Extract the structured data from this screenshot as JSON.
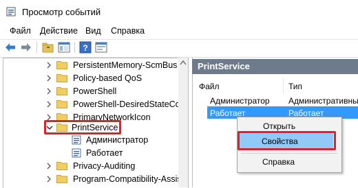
{
  "window": {
    "title": "Просмотр событий"
  },
  "menu": [
    "Файл",
    "Действие",
    "Вид",
    "Справка"
  ],
  "toolbar": {
    "icons": [
      "back-arrow-icon",
      "forward-arrow-icon",
      "folder-up-icon",
      "show-hide-tree-icon",
      "help-icon",
      "properties-icon"
    ]
  },
  "tree": {
    "items": [
      {
        "label": "PersistentMemory-ScmBus",
        "expanded": false
      },
      {
        "label": "Policy-based QoS",
        "expanded": false
      },
      {
        "label": "PowerShell",
        "expanded": false
      },
      {
        "label": "PowerShell-DesiredStateConf",
        "expanded": false
      },
      {
        "label": "PrimaryNetworkIcon",
        "expanded": false
      },
      {
        "label": "PrintService",
        "expanded": true,
        "selected": true
      },
      {
        "label": "Администратор",
        "child": true
      },
      {
        "label": "Работает",
        "child": true
      },
      {
        "label": "Privacy-Auditing",
        "expanded": false
      },
      {
        "label": "Program-Compatibility-Assis",
        "expanded": false
      }
    ]
  },
  "panel": {
    "header": "PrintService",
    "columns": [
      "Файл",
      "Тип"
    ],
    "rows": [
      {
        "file": "Администратор",
        "type": "Административны"
      },
      {
        "file": "Работает",
        "type": "Работает",
        "selected": true
      }
    ]
  },
  "context_menu": {
    "items": [
      "Открыть",
      "Свойства",
      "Справка"
    ],
    "highlighted": "Свойства"
  },
  "colors": {
    "header_bg": "#6d7b8d",
    "selection": "#3399ff",
    "highlight_box": "#e2202a",
    "menu_hover": "#91c9f7"
  }
}
